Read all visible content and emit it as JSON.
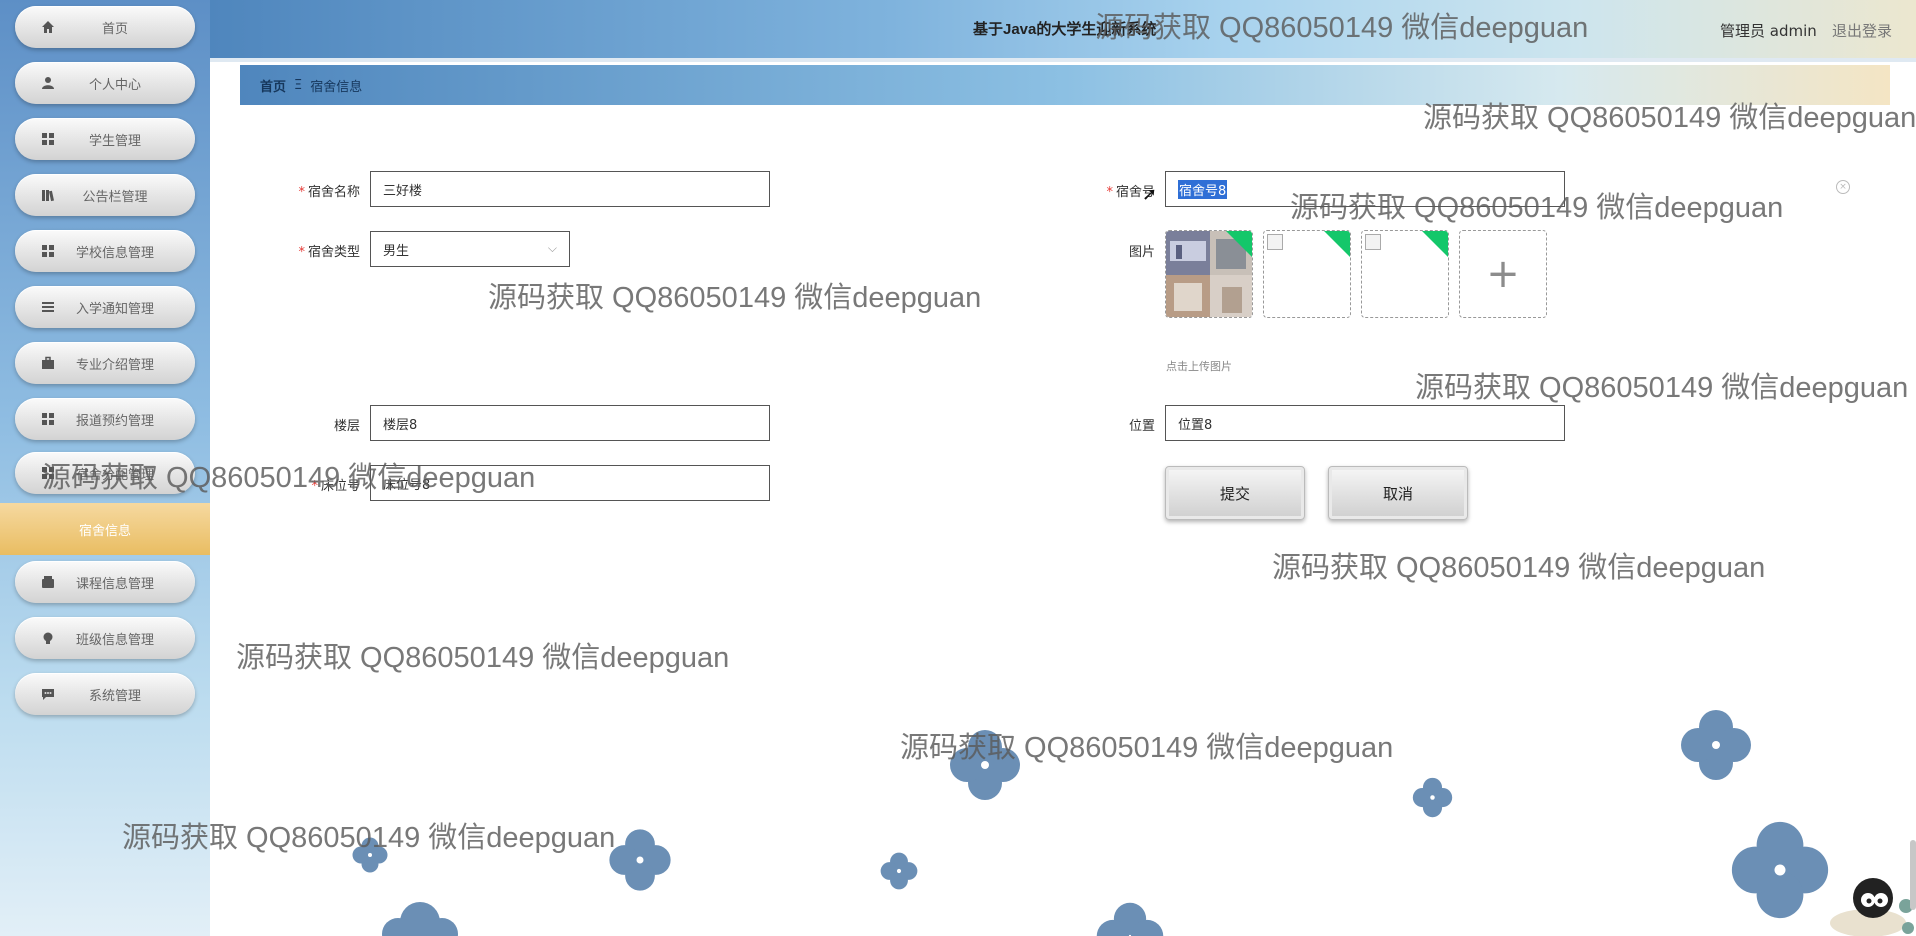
{
  "header": {
    "title": "基于Java的大学生迎新系统",
    "user": "管理员 admin",
    "logout": "退出登录"
  },
  "breadcrumb": {
    "home": "首页",
    "separator": "Ξ",
    "current": "宿舍信息"
  },
  "sidebar": {
    "items": [
      {
        "label": "首页",
        "icon": "home-icon"
      },
      {
        "label": "个人中心",
        "icon": "user-icon"
      },
      {
        "label": "学生管理",
        "icon": "grid-icon"
      },
      {
        "label": "公告栏管理",
        "icon": "book-icon"
      },
      {
        "label": "学校信息管理",
        "icon": "grid-icon"
      },
      {
        "label": "入学通知管理",
        "icon": "list-icon"
      },
      {
        "label": "专业介绍管理",
        "icon": "briefcase-icon"
      },
      {
        "label": "报道预约管理",
        "icon": "grid-icon"
      },
      {
        "label": "宿舍分配管理",
        "icon": "grid-icon"
      },
      {
        "label": "课程信息管理",
        "icon": "wallet-icon"
      },
      {
        "label": "班级信息管理",
        "icon": "bulb-icon"
      },
      {
        "label": "系统管理",
        "icon": "chat-icon"
      }
    ],
    "active_sub": "宿舍信息"
  },
  "form": {
    "dorm_name_label": "宿舍名称",
    "dorm_name_value": "三好楼",
    "dorm_no_label": "宿舍号",
    "dorm_no_value": "宿舍号8",
    "dorm_type_label": "宿舍类型",
    "dorm_type_value": "男生",
    "image_label": "图片",
    "upload_hint": "点击上传图片",
    "floor_label": "楼层",
    "floor_value": "楼层8",
    "location_label": "位置",
    "location_value": "位置8",
    "bed_label": "床位号",
    "bed_value": "床位号8",
    "submit": "提交",
    "cancel": "取消",
    "required_mark": "*",
    "plus": "+"
  },
  "watermark": "源码获取 QQ86050149 微信deepguan",
  "colors": {
    "accent": "#e9bd62",
    "flower": "#6b8fb5",
    "required": "#e53935"
  }
}
